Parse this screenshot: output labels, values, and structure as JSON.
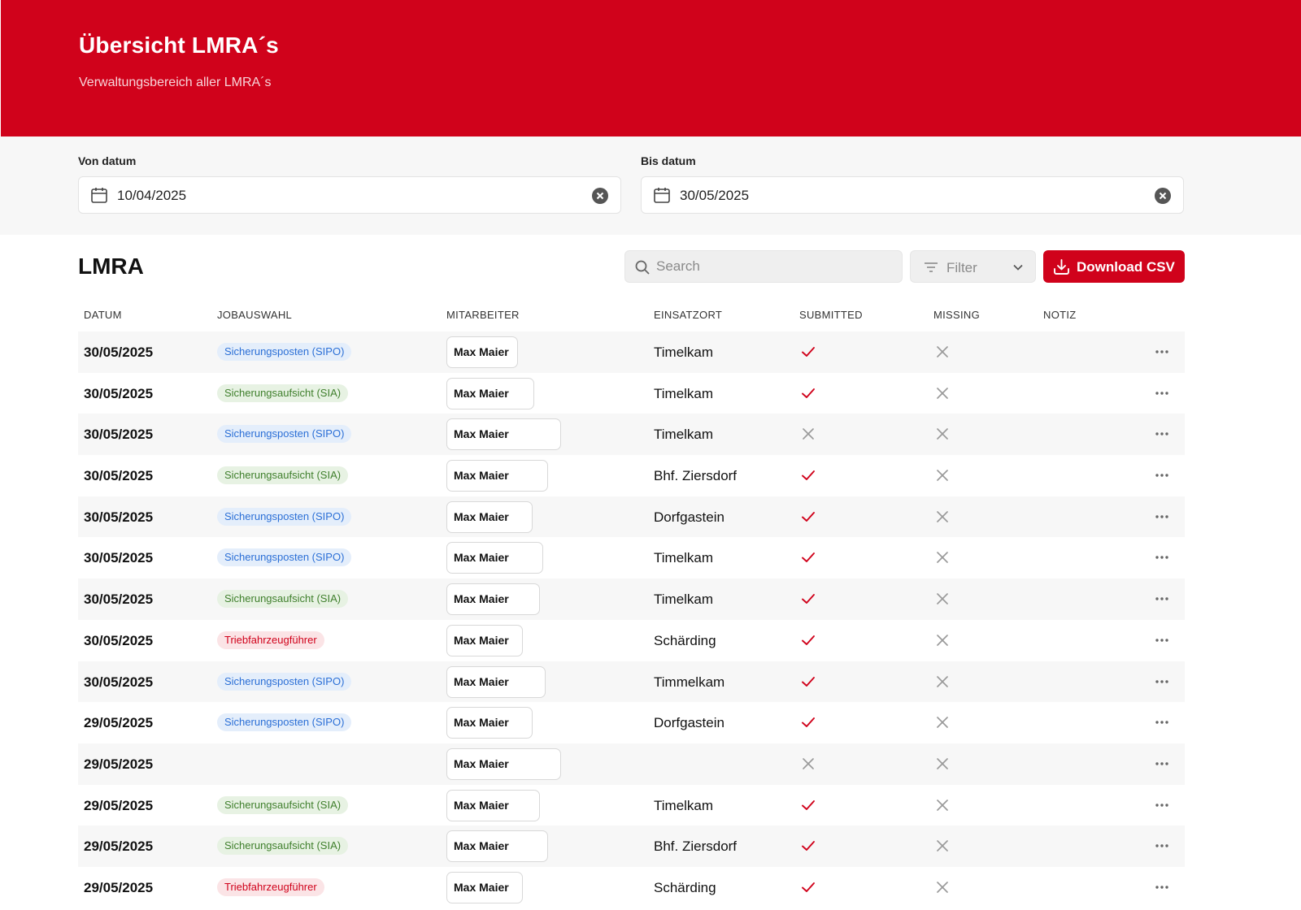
{
  "header": {
    "title": "Übersicht LMRA´s",
    "subtitle": "Verwaltungsbereich aller LMRA´s"
  },
  "filters": {
    "from_label": "Von datum",
    "from_value": "10/04/2025",
    "to_label": "Bis datum",
    "to_value": "30/05/2025"
  },
  "section": {
    "title": "LMRA"
  },
  "toolbar": {
    "search_placeholder": "Search",
    "filter_label": "Filter",
    "download_label": "Download CSV"
  },
  "colors": {
    "brand": "#d0021b",
    "check": "#d0021b",
    "cross": "#9a9a9a"
  },
  "table": {
    "columns": [
      "DATUM",
      "JOBAUSWAHL",
      "MITARBEITER",
      "EINSATZORT",
      "SUBMITTED",
      "MISSING",
      "NOTIZ"
    ],
    "rows": [
      {
        "datum": "30/05/2025",
        "job": "Sicherungsposten (SIPO)",
        "job_type": "sipo",
        "mitarbeiter": "Max Maier",
        "einsatzort": "Timelkam",
        "submitted": true,
        "missing": false,
        "notiz": ""
      },
      {
        "datum": "30/05/2025",
        "job": "Sicherungsaufsicht (SIA)",
        "job_type": "sia",
        "mitarbeiter": "Max Maier",
        "einsatzort": "Timelkam",
        "submitted": true,
        "missing": false,
        "notiz": ""
      },
      {
        "datum": "30/05/2025",
        "job": "Sicherungsposten (SIPO)",
        "job_type": "sipo",
        "mitarbeiter": "Max Maier",
        "einsatzort": "Timelkam",
        "submitted": false,
        "missing": false,
        "notiz": ""
      },
      {
        "datum": "30/05/2025",
        "job": "Sicherungsaufsicht (SIA)",
        "job_type": "sia",
        "mitarbeiter": "Max Maier",
        "einsatzort": "Bhf. Ziersdorf",
        "submitted": true,
        "missing": false,
        "notiz": ""
      },
      {
        "datum": "30/05/2025",
        "job": "Sicherungsposten (SIPO)",
        "job_type": "sipo",
        "mitarbeiter": "Max Maier",
        "einsatzort": "Dorfgastein",
        "submitted": true,
        "missing": false,
        "notiz": ""
      },
      {
        "datum": "30/05/2025",
        "job": "Sicherungsposten (SIPO)",
        "job_type": "sipo",
        "mitarbeiter": "Max Maier",
        "einsatzort": "Timelkam",
        "submitted": true,
        "missing": false,
        "notiz": ""
      },
      {
        "datum": "30/05/2025",
        "job": "Sicherungsaufsicht (SIA)",
        "job_type": "sia",
        "mitarbeiter": "Max Maier",
        "einsatzort": "Timelkam",
        "submitted": true,
        "missing": false,
        "notiz": ""
      },
      {
        "datum": "30/05/2025",
        "job": "Triebfahrzeugführer",
        "job_type": "tfz",
        "mitarbeiter": "Max Maier",
        "einsatzort": "Schärding",
        "submitted": true,
        "missing": false,
        "notiz": ""
      },
      {
        "datum": "30/05/2025",
        "job": "Sicherungsposten (SIPO)",
        "job_type": "sipo",
        "mitarbeiter": "Max Maier",
        "einsatzort": "Timmelkam",
        "submitted": true,
        "missing": false,
        "notiz": ""
      },
      {
        "datum": "29/05/2025",
        "job": "Sicherungsposten (SIPO)",
        "job_type": "sipo",
        "mitarbeiter": "Max Maier",
        "einsatzort": "Dorfgastein",
        "submitted": true,
        "missing": false,
        "notiz": ""
      },
      {
        "datum": "29/05/2025",
        "job": "",
        "job_type": "",
        "mitarbeiter": "Max Maier",
        "einsatzort": "",
        "submitted": false,
        "missing": false,
        "notiz": ""
      },
      {
        "datum": "29/05/2025",
        "job": "Sicherungsaufsicht (SIA)",
        "job_type": "sia",
        "mitarbeiter": "Max Maier",
        "einsatzort": "Timelkam",
        "submitted": true,
        "missing": false,
        "notiz": ""
      },
      {
        "datum": "29/05/2025",
        "job": "Sicherungsaufsicht (SIA)",
        "job_type": "sia",
        "mitarbeiter": "Max Maier",
        "einsatzort": "Bhf. Ziersdorf",
        "submitted": true,
        "missing": false,
        "notiz": ""
      },
      {
        "datum": "29/05/2025",
        "job": "Triebfahrzeugführer",
        "job_type": "tfz",
        "mitarbeiter": "Max Maier",
        "einsatzort": "Schärding",
        "submitted": true,
        "missing": false,
        "notiz": ""
      }
    ]
  }
}
